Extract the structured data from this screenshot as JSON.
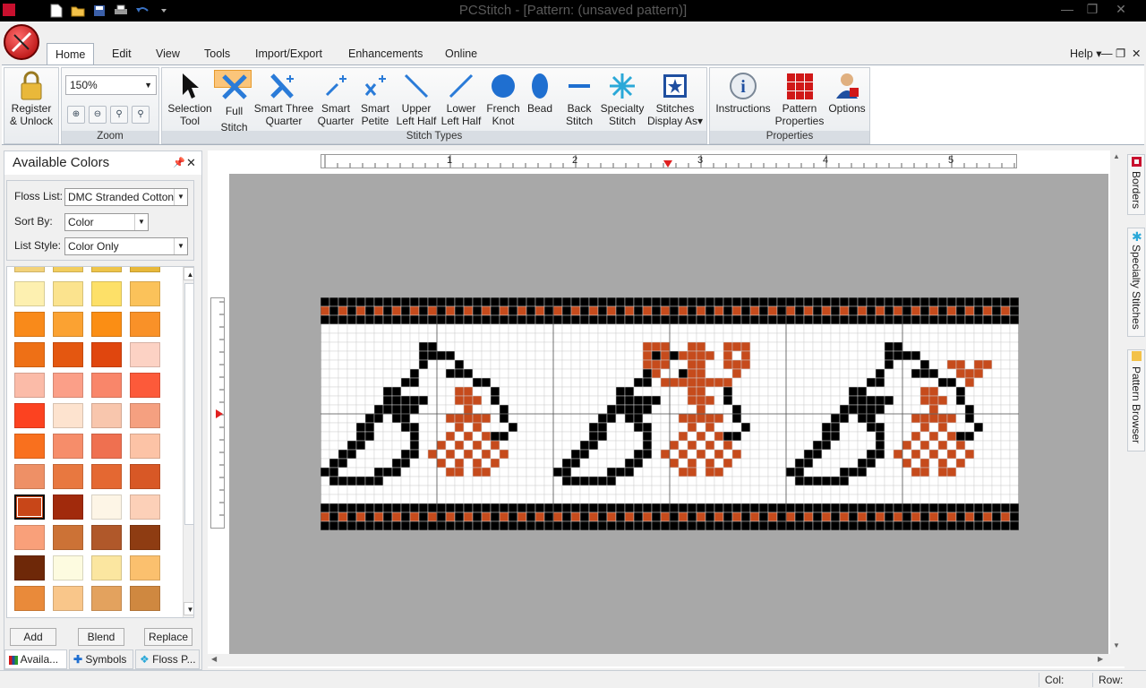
{
  "window": {
    "title": "PCStitch - [Pattern: (unsaved pattern)]"
  },
  "tabs": [
    "Home",
    "Edit",
    "View",
    "Tools",
    "Import/Export",
    "Enhancements",
    "Online"
  ],
  "help_label": "Help",
  "ribbon": {
    "register": {
      "line1": "Register",
      "line2": "& Unlock"
    },
    "zoom": {
      "value": "150%",
      "group_label": "Zoom"
    },
    "stitch_tools": [
      {
        "line1": "Selection",
        "line2": "Tool",
        "icon": "cursor-icon"
      },
      {
        "line1": "Full",
        "line2": "Stitch",
        "icon": "full-stitch-icon"
      },
      {
        "line1": "Smart Three",
        "line2": "Quarter",
        "icon": "three-quarter-stitch-icon"
      },
      {
        "line1": "Smart",
        "line2": "Quarter",
        "icon": "quarter-stitch-icon"
      },
      {
        "line1": "Smart",
        "line2": "Petite",
        "icon": "petite-stitch-icon"
      },
      {
        "line1": "Upper",
        "line2": "Left Half",
        "icon": "upper-left-half-icon"
      },
      {
        "line1": "Lower",
        "line2": "Left Half",
        "icon": "lower-left-half-icon"
      },
      {
        "line1": "French",
        "line2": "Knot",
        "icon": "french-knot-icon"
      },
      {
        "line1": "Bead",
        "line2": "",
        "icon": "bead-icon"
      },
      {
        "line1": "Back",
        "line2": "Stitch",
        "icon": "back-stitch-icon"
      },
      {
        "line1": "Specialty",
        "line2": "Stitch",
        "icon": "specialty-stitch-icon"
      },
      {
        "line1": "Stitches",
        "line2": "Display As",
        "icon": "stitches-display-icon"
      }
    ],
    "stitch_group_label": "Stitch Types",
    "properties": [
      {
        "line1": "Instructions",
        "line2": "",
        "icon": "info-icon"
      },
      {
        "line1": "Pattern",
        "line2": "Properties",
        "icon": "pattern-properties-icon"
      },
      {
        "line1": "Options",
        "line2": "",
        "icon": "options-icon"
      }
    ],
    "properties_group_label": "Properties"
  },
  "left_panel": {
    "title": "Available Colors",
    "floss_list_label": "Floss List:",
    "floss_list_value": "DMC Stranded Cotton",
    "sort_by_label": "Sort By:",
    "sort_by_value": "Color",
    "list_style_label": "List Style:",
    "list_style_value": "Color Only",
    "swatches": [
      [
        "#f3d27a",
        "#f2cd5e",
        "#eec44a",
        "#e8b83a"
      ],
      [
        "#fdf0b0",
        "#fbe38e",
        "#fde068",
        "#fbc25a"
      ],
      [
        "#f98a1a",
        "#fba232",
        "#fb8e14",
        "#f99128"
      ],
      [
        "#ee7016",
        "#e45710",
        "#e0460e",
        "#fcd2c4"
      ],
      [
        "#fbbba8",
        "#fb9f88",
        "#f9866a",
        "#fc5a3a"
      ],
      [
        "#fc4220",
        "#fde3cf",
        "#f8c6ad",
        "#f5a080"
      ],
      [
        "#f9701e",
        "#f68d6a",
        "#ef7050",
        "#fcc3a6"
      ],
      [
        "#ee9066",
        "#e87840",
        "#e46832",
        "#d85826"
      ],
      [
        "#c84618",
        "#a12a0c",
        "#fdf5e6",
        "#fcd0b8"
      ],
      [
        "#f9a07a",
        "#cc7236",
        "#b0582a",
        "#8e3c12"
      ],
      [
        "#6e2808",
        "#fdfbe0",
        "#fbe6a0",
        "#fbc06e"
      ],
      [
        "#e98a3a",
        "#f9c68a",
        "#e3a25e",
        "#cf8840"
      ]
    ],
    "buttons": [
      "Add",
      "Blend",
      "Replace"
    ],
    "bottom_tabs": [
      "Availa...",
      "Symbols",
      "Floss P..."
    ]
  },
  "ruler_labels": [
    "1",
    "2",
    "3",
    "4",
    "5"
  ],
  "right_tabs": [
    "Borders",
    "Specialty Stitches",
    "Pattern Browser"
  ],
  "status": {
    "col_label": "Col:",
    "row_label": "Row:"
  },
  "pattern_colors": {
    "black": "#000000",
    "rust": "#c64b1c",
    "grid": "#d0d0d0"
  }
}
